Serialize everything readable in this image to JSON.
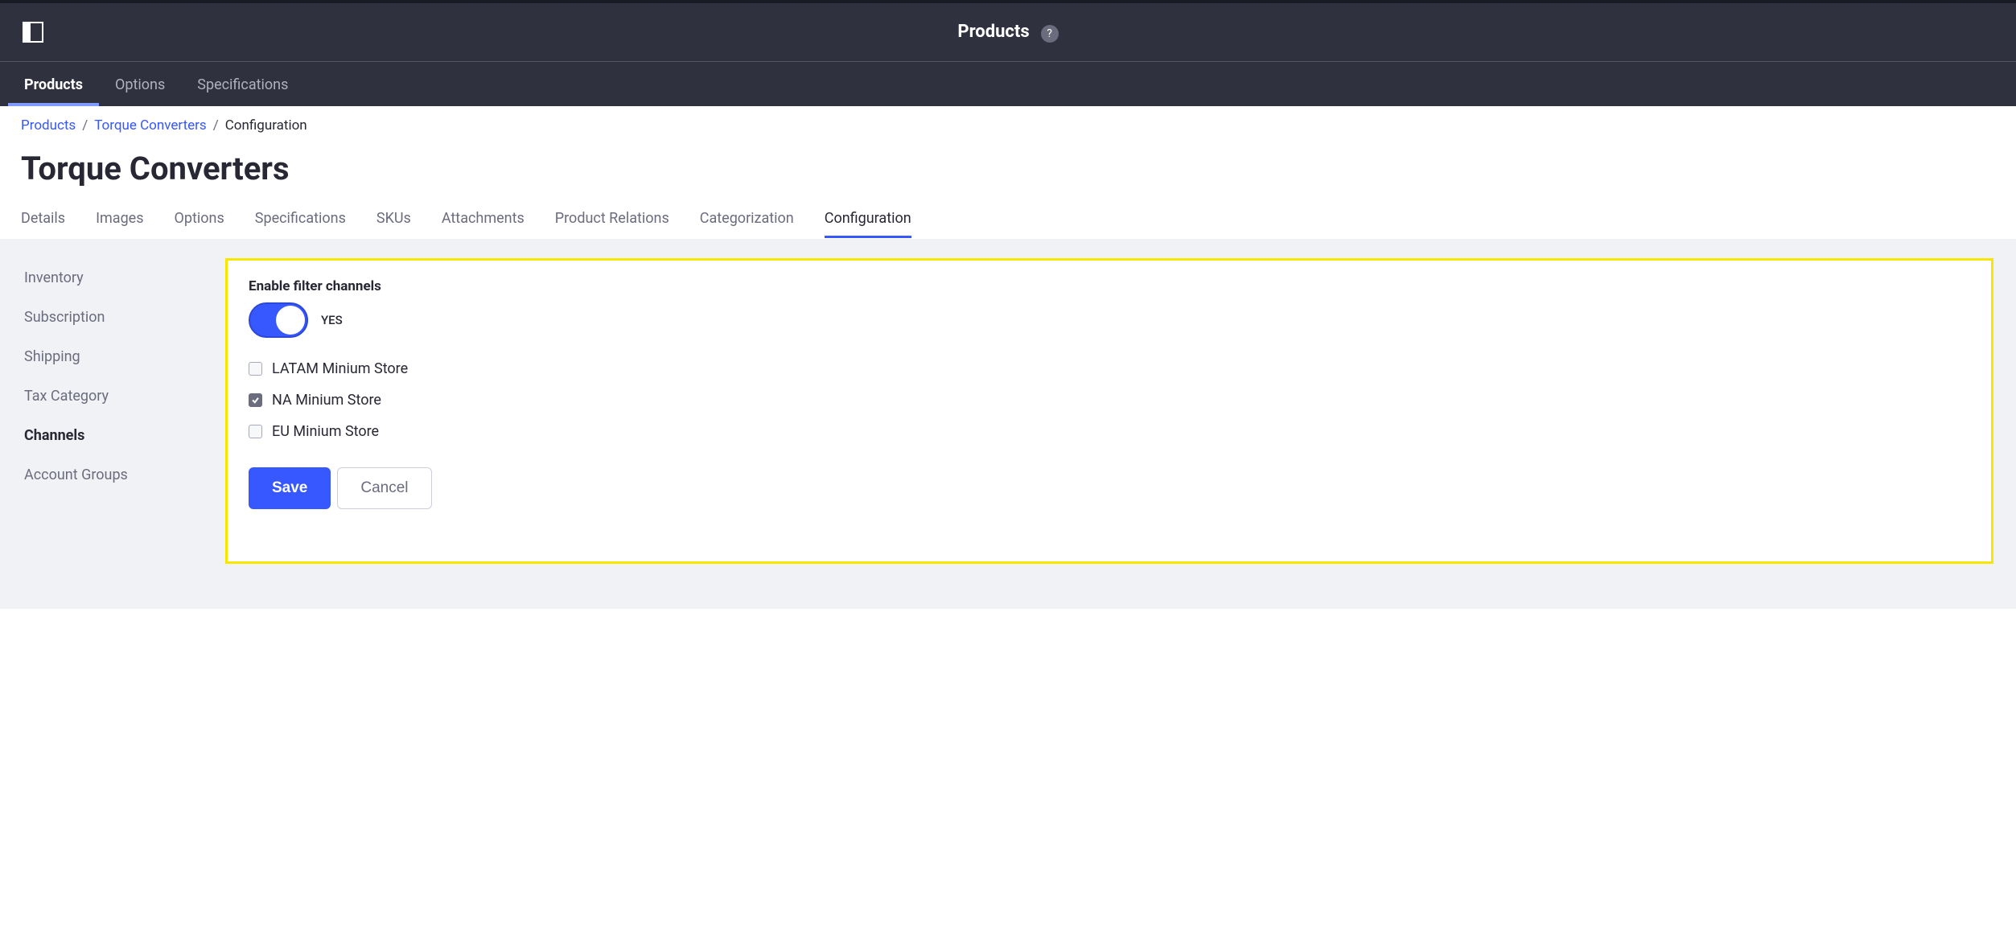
{
  "header": {
    "title": "Products",
    "help_icon": "?"
  },
  "primary_nav": {
    "items": [
      {
        "label": "Products",
        "active": true
      },
      {
        "label": "Options",
        "active": false
      },
      {
        "label": "Specifications",
        "active": false
      }
    ]
  },
  "breadcrumb": {
    "items": [
      {
        "label": "Products",
        "link": true
      },
      {
        "label": "Torque Converters",
        "link": true
      },
      {
        "label": "Configuration",
        "link": false
      }
    ]
  },
  "page_title": "Torque Converters",
  "detail_tabs": {
    "items": [
      {
        "label": "Details",
        "active": false
      },
      {
        "label": "Images",
        "active": false
      },
      {
        "label": "Options",
        "active": false
      },
      {
        "label": "Specifications",
        "active": false
      },
      {
        "label": "SKUs",
        "active": false
      },
      {
        "label": "Attachments",
        "active": false
      },
      {
        "label": "Product Relations",
        "active": false
      },
      {
        "label": "Categorization",
        "active": false
      },
      {
        "label": "Configuration",
        "active": true
      }
    ]
  },
  "side_nav": {
    "items": [
      {
        "label": "Inventory",
        "active": false
      },
      {
        "label": "Subscription",
        "active": false
      },
      {
        "label": "Shipping",
        "active": false
      },
      {
        "label": "Tax Category",
        "active": false
      },
      {
        "label": "Channels",
        "active": true
      },
      {
        "label": "Account Groups",
        "active": false
      }
    ]
  },
  "config": {
    "toggle_label": "Enable filter channels",
    "toggle_on": true,
    "toggle_state_text": "YES",
    "channels": [
      {
        "label": "LATAM Minium Store",
        "checked": false
      },
      {
        "label": "NA Minium Store",
        "checked": true
      },
      {
        "label": "EU Minium Store",
        "checked": false
      }
    ],
    "save_label": "Save",
    "cancel_label": "Cancel"
  },
  "colors": {
    "accent": "#3757ff",
    "highlight_border": "#f7e600",
    "dark_bg": "#30313f"
  }
}
